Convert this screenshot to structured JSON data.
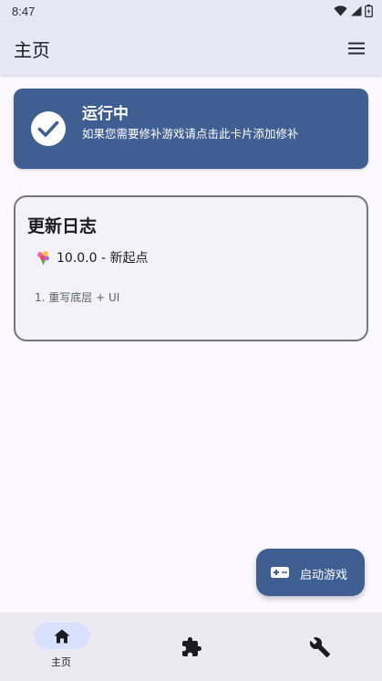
{
  "status_bar": {
    "time": "8:47"
  },
  "header": {
    "title": "主页"
  },
  "status_card": {
    "title": "运行中",
    "subtitle": "如果您需要修补游戏请点击此卡片添加修补"
  },
  "changelog": {
    "title": "更新日志",
    "version": "10.0.0 - 新起点",
    "items": [
      "1. 重写底层 + UI"
    ]
  },
  "fab": {
    "label": "启动游戏"
  },
  "bottom_nav": {
    "items": [
      {
        "label": "主页",
        "icon": "home-icon",
        "selected": true
      },
      {
        "label": "",
        "icon": "puzzle-icon",
        "selected": false
      },
      {
        "label": "",
        "icon": "wrench-icon",
        "selected": false
      }
    ]
  },
  "colors": {
    "primary": "#3f5f92",
    "app_bar": "#e6e8f4",
    "nav_pill": "#d8e2ff",
    "background": "#fbf8ff"
  }
}
